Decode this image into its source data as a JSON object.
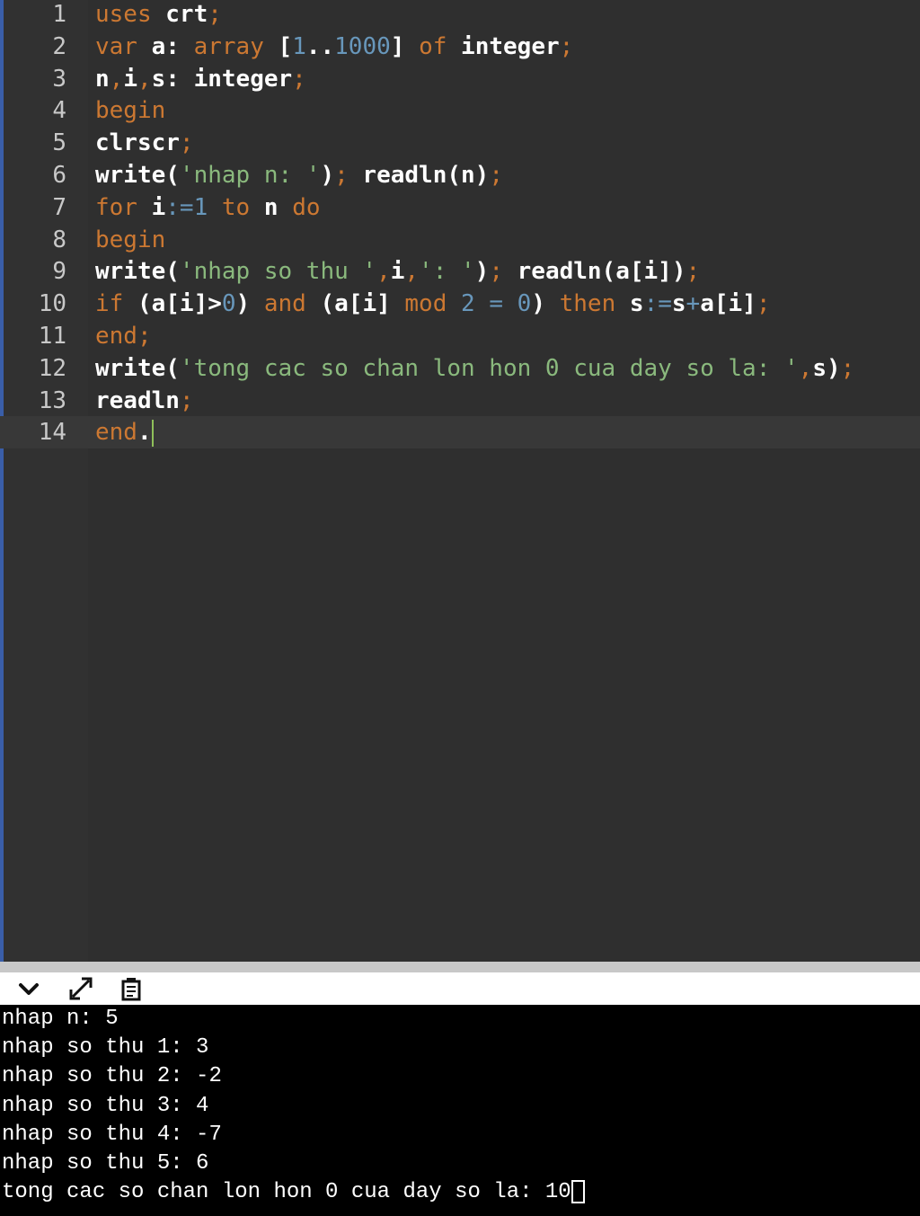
{
  "editor": {
    "lines": [
      {
        "n": "1",
        "tokens": [
          [
            "kw",
            "uses"
          ],
          [
            "id",
            " crt"
          ],
          [
            "pn",
            ";"
          ]
        ]
      },
      {
        "n": "2",
        "tokens": [
          [
            "kw",
            "var"
          ],
          [
            "id",
            " a: "
          ],
          [
            "kw",
            "array"
          ],
          [
            "id",
            " ["
          ],
          [
            "num",
            "1"
          ],
          [
            "id",
            ".."
          ],
          [
            "num",
            "1000"
          ],
          [
            "id",
            "] "
          ],
          [
            "kw",
            "of"
          ],
          [
            "id",
            " integer"
          ],
          [
            "pn",
            ";"
          ]
        ]
      },
      {
        "n": "3",
        "tokens": [
          [
            "id",
            "n"
          ],
          [
            "pn",
            ","
          ],
          [
            "id",
            "i"
          ],
          [
            "pn",
            ","
          ],
          [
            "id",
            "s: integer"
          ],
          [
            "pn",
            ";"
          ]
        ]
      },
      {
        "n": "4",
        "tokens": [
          [
            "kw",
            "begin"
          ]
        ]
      },
      {
        "n": "5",
        "tokens": [
          [
            "id",
            "clrscr"
          ],
          [
            "pn",
            ";"
          ]
        ]
      },
      {
        "n": "6",
        "tokens": [
          [
            "id",
            "write("
          ],
          [
            "str",
            "'nhap n: '"
          ],
          [
            "id",
            ")"
          ],
          [
            "pn",
            ";"
          ],
          [
            "id",
            " readln(n)"
          ],
          [
            "pn",
            ";"
          ]
        ]
      },
      {
        "n": "7",
        "tokens": [
          [
            "kw",
            "for"
          ],
          [
            "id",
            " i"
          ],
          [
            "num",
            ":="
          ],
          [
            "num",
            "1"
          ],
          [
            "id",
            " "
          ],
          [
            "kw",
            "to"
          ],
          [
            "id",
            " n "
          ],
          [
            "kw",
            "do"
          ]
        ]
      },
      {
        "n": "8",
        "tokens": [
          [
            "kw",
            "begin"
          ]
        ]
      },
      {
        "n": "9",
        "tokens": [
          [
            "id",
            "write("
          ],
          [
            "str",
            "'nhap so thu '"
          ],
          [
            "pn",
            ","
          ],
          [
            "id",
            "i"
          ],
          [
            "pn",
            ","
          ],
          [
            "str",
            "': '"
          ],
          [
            "id",
            ")"
          ],
          [
            "pn",
            ";"
          ],
          [
            "id",
            " readln(a[i])"
          ],
          [
            "pn",
            ";"
          ]
        ]
      },
      {
        "n": "10",
        "tokens": [
          [
            "kw",
            "if"
          ],
          [
            "id",
            " (a[i]>"
          ],
          [
            "num",
            "0"
          ],
          [
            "id",
            ") "
          ],
          [
            "kw",
            "and"
          ],
          [
            "id",
            " (a[i] "
          ],
          [
            "kw",
            "mod"
          ],
          [
            "id",
            " "
          ],
          [
            "num",
            "2"
          ],
          [
            "id",
            " "
          ],
          [
            "num",
            "="
          ],
          [
            "id",
            " "
          ],
          [
            "num",
            "0"
          ],
          [
            "id",
            ") "
          ],
          [
            "kw",
            "then"
          ],
          [
            "id",
            " s"
          ],
          [
            "num",
            ":="
          ],
          [
            "id",
            "s"
          ],
          [
            "num",
            "+"
          ],
          [
            "id",
            "a[i]"
          ],
          [
            "pn",
            ";"
          ]
        ]
      },
      {
        "n": "11",
        "tokens": [
          [
            "kw",
            "end"
          ],
          [
            "pn",
            ";"
          ]
        ]
      },
      {
        "n": "12",
        "tokens": [
          [
            "id",
            "write("
          ],
          [
            "str",
            "'tong cac so chan lon hon 0 cua day so la: '"
          ],
          [
            "pn",
            ","
          ],
          [
            "id",
            "s)"
          ],
          [
            "pn",
            ";"
          ]
        ]
      },
      {
        "n": "13",
        "tokens": [
          [
            "id",
            "readln"
          ],
          [
            "pn",
            ";"
          ]
        ]
      },
      {
        "n": "14",
        "tokens": [
          [
            "kw",
            "end"
          ],
          [
            "id",
            "."
          ]
        ]
      }
    ]
  },
  "toolbar": {
    "collapse_icon": "chevron-down-icon",
    "expand_icon": "expand-arrows-icon",
    "clear_icon": "clear-console-icon"
  },
  "console": {
    "lines": [
      "nhap n: 5",
      "nhap so thu 1: 3",
      "nhap so thu 2: -2",
      "nhap so thu 3: 4",
      "nhap so thu 4: -7",
      "nhap so thu 5: 6",
      "tong cac so chan lon hon 0 cua day so la: 10"
    ]
  },
  "colors": {
    "editor_bg": "#2f2f2f",
    "keyword": "#cc7832",
    "number": "#6897bb",
    "string": "#8ab97d",
    "console_bg": "#000000"
  }
}
